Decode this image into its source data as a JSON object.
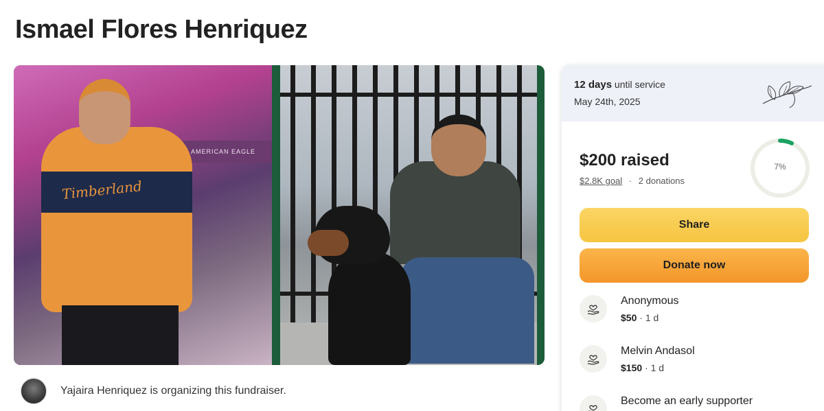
{
  "page": {
    "title": "Ismael Flores Henriquez"
  },
  "hero": {
    "left_photo_sign": "AMERICAN EAGLE",
    "left_photo_hoodie": "Timberland"
  },
  "organizer": {
    "text": "Yajaira Henriquez is organizing this fundraiser."
  },
  "service": {
    "days": "12 days",
    "days_suffix": " until service",
    "date": "May 24th, 2025",
    "icon": "flower-illustration-icon"
  },
  "progress": {
    "raised": "$200 raised",
    "goal": "$2.8K goal",
    "separator": "·",
    "donations": "2 donations",
    "percent_label": "7%",
    "percent_value": 0.07,
    "ring_color": "#1aa260",
    "ring_track_color": "#eceee6"
  },
  "buttons": {
    "share": "Share",
    "donate": "Donate now",
    "share_color": "#f6c440",
    "donate_color": "#f3962a"
  },
  "donors": [
    {
      "name": "Anonymous",
      "amount": "$50",
      "time": "1 d",
      "icon": "heart-hand-icon"
    },
    {
      "name": "Melvin Andasol",
      "amount": "$150",
      "time": "1 d",
      "icon": "heart-hand-icon"
    },
    {
      "name": "Become an early supporter",
      "icon": "heart-hand-icon"
    }
  ]
}
